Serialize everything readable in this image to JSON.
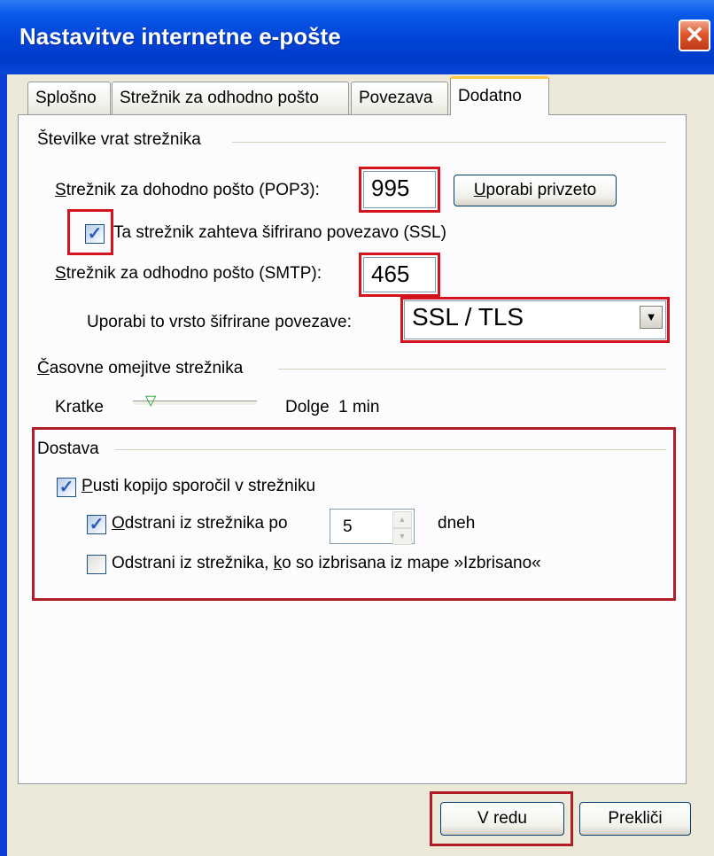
{
  "window": {
    "title": "Nastavitve internetne e-pošte",
    "close_glyph": "✕"
  },
  "tabs": [
    {
      "label": "Splošno",
      "active": false
    },
    {
      "label": "Strežnik za odhodno pošto",
      "active": false
    },
    {
      "label": "Povezava",
      "active": false
    },
    {
      "label": "Dodatno",
      "active": true
    }
  ],
  "ports": {
    "group_title": "Številke vrat strežnika",
    "pop3_label": "Strežnik za dohodno pošto (POP3):",
    "pop3_value": "995",
    "default_button": "Uporabi privzeto",
    "ssl_checkbox_label": "Ta strežnik zahteva šifrirano povezavo (SSL)",
    "ssl_checked": true,
    "smtp_label": "Strežnik za odhodno pošto (SMTP):",
    "smtp_value": "465",
    "encryption_label": "Uporabi to vrsto šifrirane povezave:",
    "encryption_value": "SSL / TLS"
  },
  "timeouts": {
    "group_title": "Časovne omejitve strežnika",
    "short_label": "Kratke",
    "long_label": "Dolge",
    "value_text": "1 min",
    "slider_level": 0.1
  },
  "delivery": {
    "group_title": "Dostava",
    "leave_copy_label": "Pusti kopijo sporočil v strežniku",
    "leave_copy_checked": true,
    "remove_after_label": "Odstrani iz strežnika po",
    "remove_after_checked": true,
    "days_value": "5",
    "days_unit": "dneh",
    "remove_deleted_label": "Odstrani iz strežnika, ko so izbrisana iz mape »Izbrisano«",
    "remove_deleted_checked": false
  },
  "footer": {
    "ok_label": "V redu",
    "cancel_label": "Prekliči"
  },
  "colors": {
    "highlight": "#d4141c",
    "titlebar": "#0042d6",
    "dialog_bg": "#ece9d8"
  }
}
